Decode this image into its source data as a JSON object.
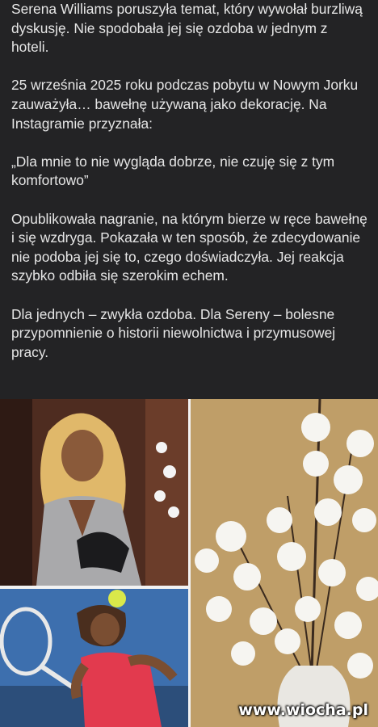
{
  "post": {
    "paragraphs": [
      "Serena Williams poruszyła temat, który wywołał burzliwą dyskusję. Nie spodobała jej się ozdoba w jednym z hoteli.",
      "25 września 2025 roku podczas pobytu w Nowym Jorku zauważyła… bawełnę używaną jako dekorację. Na Instagramie przyznała:",
      "„Dla mnie to nie wygląda dobrze, nie czuję się z tym komfortowo”",
      "Opublikowała nagranie, na którym bierze w ręce bawełnę i się wzdryga. Pokazała w ten sposób, że zdecydowanie nie podoba jej się to, czego doświadczyła. Jej reakcja szybko odbiła się szerokim echem.",
      "Dla jednych – zwykła ozdoba. Dla Sereny – bolesne przypomnienie o historii niewolnictwa i przymusowej pracy."
    ]
  },
  "watermark": "www.wiocha.pl",
  "colors": {
    "background": "#232325",
    "text": "#e6e6e6"
  }
}
